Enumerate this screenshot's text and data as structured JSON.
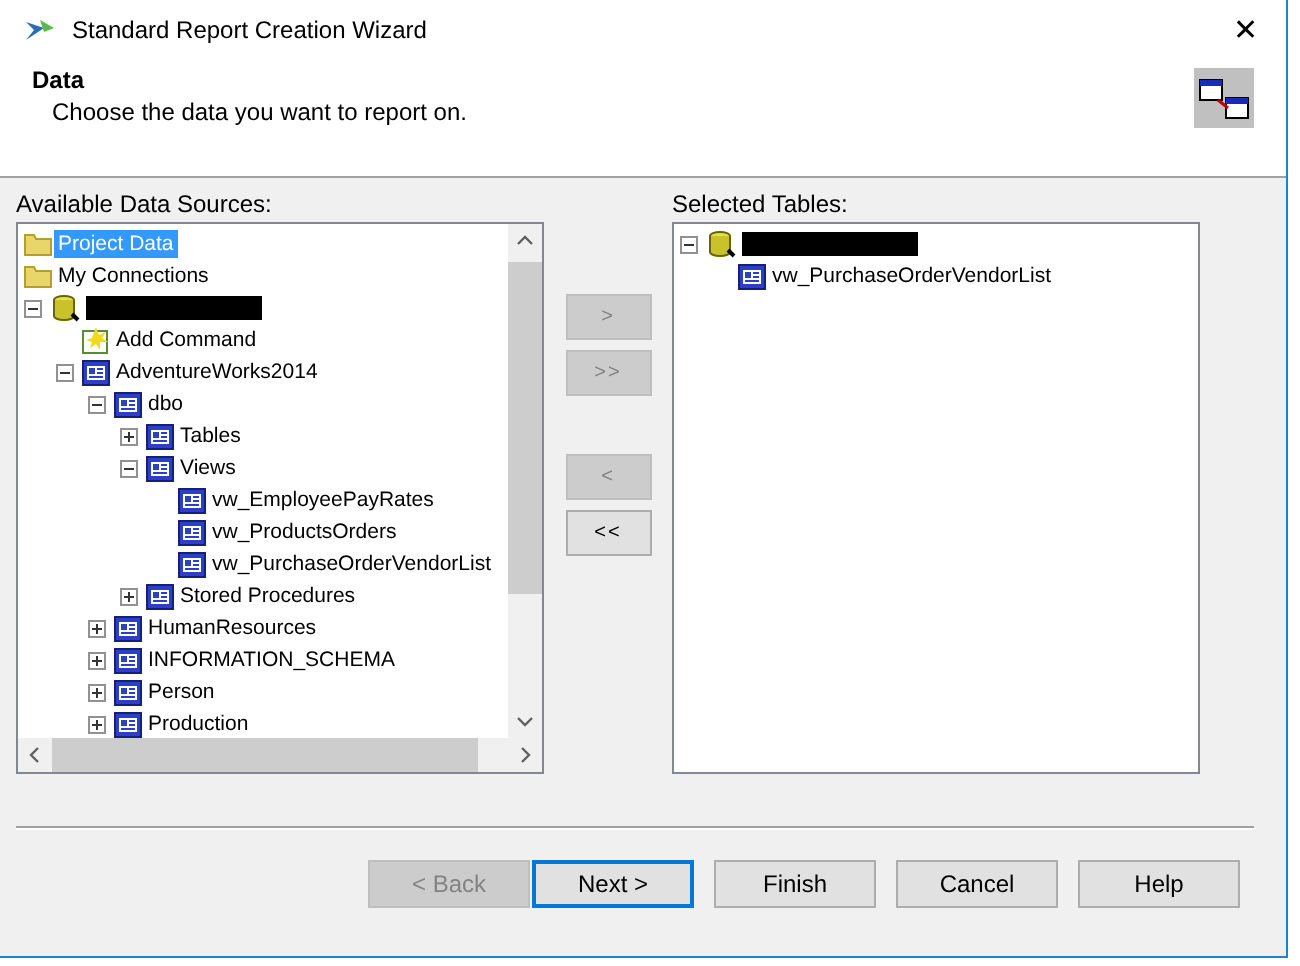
{
  "window": {
    "title": "Standard Report Creation Wizard",
    "close": "✕"
  },
  "header": {
    "title": "Data",
    "subtitle": "Choose the data you want to report on."
  },
  "available": {
    "label": "Available Data Sources:",
    "tree": [
      {
        "label": "Project Data",
        "kind": "folder",
        "selected": true
      },
      {
        "label": "My Connections",
        "kind": "folder",
        "selected": false
      },
      {
        "kind": "connection",
        "expanded": true,
        "children": [
          {
            "label": "Add Command",
            "kind": "command",
            "selected": false
          },
          {
            "label": "AdventureWorks2014",
            "kind": "object",
            "selected": false,
            "expanded": true,
            "children": [
              {
                "label": "dbo",
                "kind": "object",
                "selected": false,
                "expanded": true,
                "children": [
                  {
                    "label": "Tables",
                    "kind": "object",
                    "selected": false,
                    "expanded": false
                  },
                  {
                    "label": "Views",
                    "kind": "object",
                    "selected": false,
                    "expanded": true,
                    "children": [
                      {
                        "label": "vw_EmployeePayRates",
                        "kind": "object",
                        "selected": false
                      },
                      {
                        "label": "vw_ProductsOrders",
                        "kind": "object",
                        "selected": false
                      },
                      {
                        "label": "vw_PurchaseOrderVendorList",
                        "kind": "object",
                        "selected": false
                      }
                    ]
                  },
                  {
                    "label": "Stored Procedures",
                    "kind": "object",
                    "selected": false,
                    "expanded": false
                  }
                ]
              },
              {
                "label": "HumanResources",
                "kind": "object",
                "selected": false,
                "expanded": false
              },
              {
                "label": "INFORMATION_SCHEMA",
                "kind": "object",
                "selected": false,
                "expanded": false
              },
              {
                "label": "Person",
                "kind": "object",
                "selected": false,
                "expanded": false
              },
              {
                "label": "Production",
                "kind": "object",
                "selected": false,
                "expanded": false
              }
            ]
          }
        ]
      }
    ]
  },
  "transfer_buttons": [
    {
      "label": ">",
      "disabled": true
    },
    {
      "label": ">>",
      "disabled": true
    },
    {
      "label": "<",
      "disabled": true
    },
    {
      "label": "<<",
      "disabled": false
    }
  ],
  "selected": {
    "label": "Selected Tables:",
    "tree": [
      {
        "kind": "connection",
        "expanded": true,
        "children": [
          {
            "label": "vw_PurchaseOrderVendorList",
            "kind": "object",
            "selected": false
          }
        ]
      }
    ]
  },
  "buttons": [
    {
      "label": "< Back",
      "disabled": true,
      "default": false
    },
    {
      "label": "Next >",
      "disabled": false,
      "default": true
    },
    {
      "label": "Finish",
      "disabled": false,
      "default": false
    },
    {
      "label": "Cancel",
      "disabled": false,
      "default": false
    },
    {
      "label": "Help",
      "disabled": false,
      "default": false
    }
  ]
}
